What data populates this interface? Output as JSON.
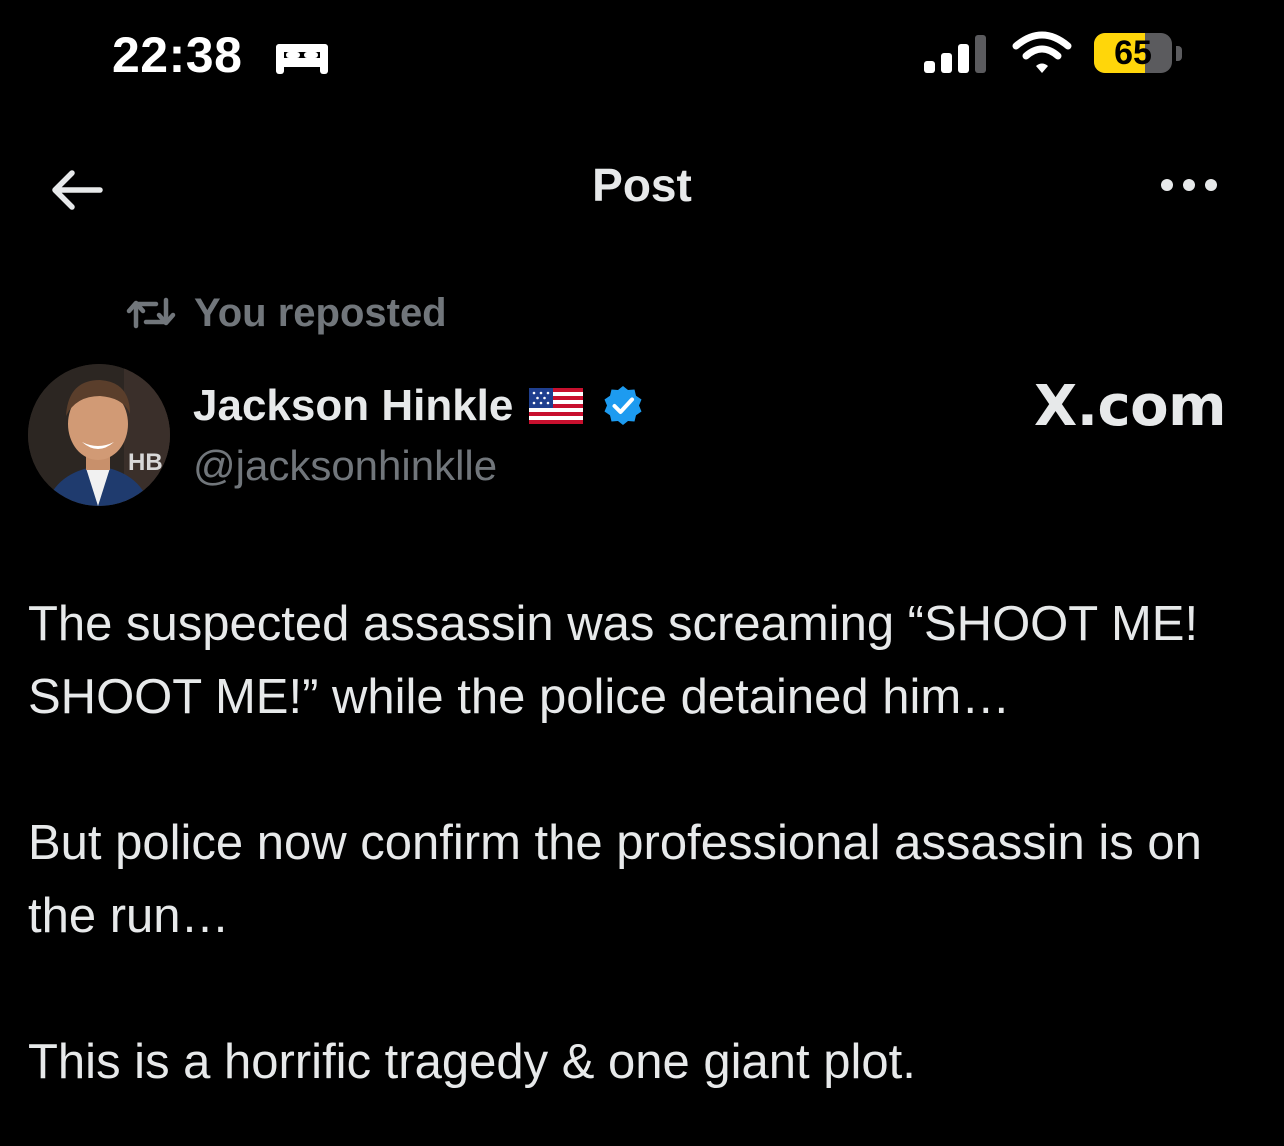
{
  "status_bar": {
    "time": "22:38",
    "sleep_icon": "bed-icon",
    "signal_icon": "cellular-signal-icon",
    "wifi_icon": "wifi-icon",
    "battery_level": "65",
    "battery_fraction": 0.65,
    "battery_color": "#ffd60a"
  },
  "header": {
    "title": "Post",
    "back_icon": "arrow-left-icon",
    "more_icon": "more-dots-icon"
  },
  "repost_context": {
    "icon": "repost-icon",
    "text": "You reposted"
  },
  "author": {
    "name": "Jackson Hinkle",
    "handle": "@jacksonhinklle",
    "flag_icon": "us-flag-icon",
    "verified_icon": "verified-badge-icon",
    "verified_color": "#1d9bf0",
    "avatar_text": "HB"
  },
  "watermark": "X.com",
  "post": {
    "paragraphs": [
      "The suspected assassin was screaming “SHOOT ME! SHOOT ME!” while the police detained him…",
      "But police now confirm the professional assassin is on the run…",
      "This is a horrific tragedy & one giant plot."
    ]
  }
}
